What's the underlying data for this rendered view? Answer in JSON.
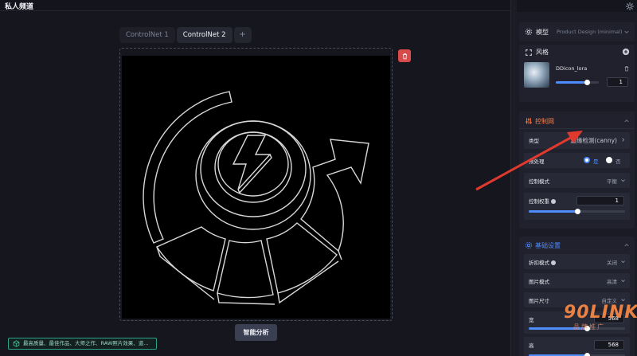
{
  "header": {
    "title": "私人频道"
  },
  "canvas": {
    "tabs": [
      {
        "label": "ControlNet 1"
      },
      {
        "label": "ControlNet 2"
      },
      {
        "label": "+"
      }
    ],
    "analyze_label": "智能分析",
    "prompt_text": "最高质量、最佳作品、大师之作、RAW照片效果、道..."
  },
  "panel": {
    "model": {
      "label": "模型",
      "value": "Product Design (minimal)"
    },
    "style": {
      "label": "风格",
      "lora_name": "DDicon_lora",
      "weight": "1",
      "weight_fraction": 0.72
    },
    "controlnet": {
      "label": "控制网",
      "type_label": "类型",
      "type_value": "边缘检测(canny)",
      "preprocess_label": "预处理",
      "preprocess_yes": "是",
      "preprocess_no": "否",
      "mode_label": "控制模式",
      "mode_value": "平衡",
      "weight_label": "控制权重",
      "weight_value": "1",
      "weight_fraction": 0.5
    },
    "base": {
      "label": "基础设置",
      "rows": [
        {
          "k": "折扣模式",
          "v": "关闭"
        },
        {
          "k": "图片模式",
          "v": "高清"
        },
        {
          "k": "图片尺寸",
          "v": "自定义"
        }
      ],
      "width_label": "宽",
      "width_value": "568",
      "width_fraction": 0.6,
      "height_label": "高",
      "height_value": "568",
      "height_fraction": 0.6
    }
  },
  "watermark": {
    "main": "90LINK",
    "sub": "品牌推广"
  }
}
